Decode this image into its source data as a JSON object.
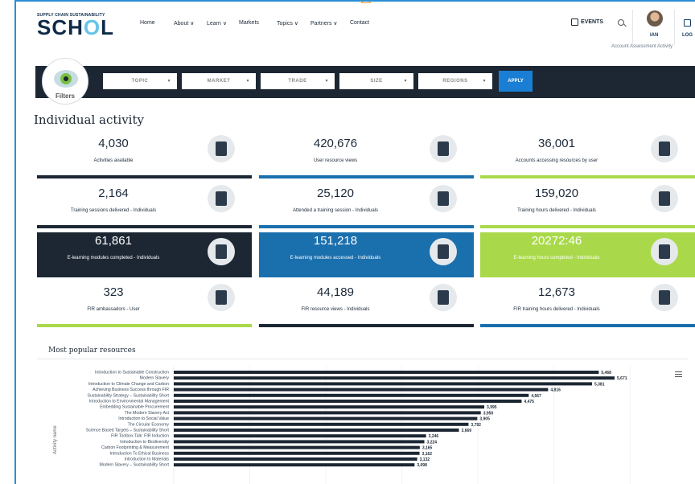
{
  "header": {
    "logo_small": "SUPPLY CHAIN SUSTAINABILITY",
    "logo_big_prefix": "SCH",
    "logo_big_o": "O",
    "logo_big_suffix": "L",
    "nav": [
      "Home",
      "About",
      "Learn",
      "Markets",
      "Topics",
      "Partners",
      "Contact"
    ],
    "events_label": "EVENTS",
    "user_name": "IAN",
    "login_label": "LOG",
    "sublinks": "Account   Assessment   Activity"
  },
  "filters": {
    "label": "Filters",
    "selects": [
      "TOPIC",
      "MARKET",
      "TRADE",
      "SIZE",
      "REGIONS"
    ],
    "apply_label": "APPLY"
  },
  "section_title": "Individual activity",
  "cards": [
    {
      "value": "4,030",
      "label": "Activities available",
      "icon": "clipboard-icon",
      "style": "light",
      "bar": "#1c2733"
    },
    {
      "value": "420,676",
      "label": "User resource views",
      "icon": "eye-icon",
      "style": "light",
      "bar": "#1a6fad"
    },
    {
      "value": "36,001",
      "label": "Accounts accessing resources by user",
      "icon": "book-icon",
      "style": "light",
      "bar": "#a9d94a"
    },
    {
      "value": "2,164",
      "label": "Training sessions delivered - Individuals",
      "icon": "presentation-icon",
      "style": "light",
      "bar": "#1c2733"
    },
    {
      "value": "25,120",
      "label": "Attended a training session - Individuals",
      "icon": "group-icon",
      "style": "light",
      "bar": "#1a6fad"
    },
    {
      "value": "159,020",
      "label": "Training hours delivered - Individuals",
      "icon": "training-clock-icon",
      "style": "light",
      "bar": "#a9d94a"
    },
    {
      "value": "61,861",
      "label": "E-learning modules completed - Individuals",
      "icon": "certificate-icon",
      "style": "dark",
      "bar": ""
    },
    {
      "value": "151,218",
      "label": "E-learning modules accessed - Individuals",
      "icon": "document-icon",
      "style": "blue",
      "bar": ""
    },
    {
      "value": "20272:46",
      "label": "E-learning hours completed - Individuals",
      "icon": "stopwatch-icon",
      "style": "green",
      "bar": ""
    },
    {
      "value": "323",
      "label": "FIR ambassadors - User",
      "icon": "award-icon",
      "style": "light",
      "bar": "#a9d94a"
    },
    {
      "value": "44,189",
      "label": "FIR resource views - Individuals",
      "icon": "fir-document-icon",
      "style": "light",
      "bar": "#1c2733"
    },
    {
      "value": "12,673",
      "label": "FIR training hours delivered - Individuals",
      "icon": "fir-training-icon",
      "style": "light",
      "bar": "#1a6fad"
    }
  ],
  "chart_title": "Most popular resources",
  "chart_data": {
    "type": "bar",
    "orientation": "horizontal",
    "ylabel": "Activity name",
    "bar_color": "#1c2733",
    "xlim": [
      0,
      6000
    ],
    "categories": [
      "Introduction to Sustainable Construction",
      "Modern Slavery",
      "Introduction to Climate Change and Carbon",
      "Achieving Business Success through FIR",
      "Sustainability Strategy – Sustainability Short",
      "Introduction to Environmental Management",
      "Embedding Sustainable Procurement",
      "The Modern Slavery Act",
      "Introduction to Social Value",
      "The Circular Economy",
      "Science Based Targets – Sustainability Short",
      "FIR Toolbox Talk: FIR Induction",
      "Introduction to Biodiversity",
      "Carbon Footprinting & Measurement",
      "Introduction To Ethical Business",
      "Introduction to Materials",
      "Modern Slavery – Sustainability Short"
    ],
    "values": [
      5468,
      5671,
      5381,
      4816,
      4567,
      4475,
      3995,
      3950,
      3905,
      3792,
      3669,
      3246,
      3224,
      3165,
      3162,
      3132,
      3098
    ],
    "value_labels": [
      "5,468",
      "5,671",
      "5,381",
      "4,816",
      "4,567",
      "4,475",
      "3,995",
      "3,950",
      "3,905",
      "3,792",
      "3,669",
      "3,246",
      "3,224",
      "3,165",
      "3,162",
      "3,132",
      "3,098"
    ]
  }
}
